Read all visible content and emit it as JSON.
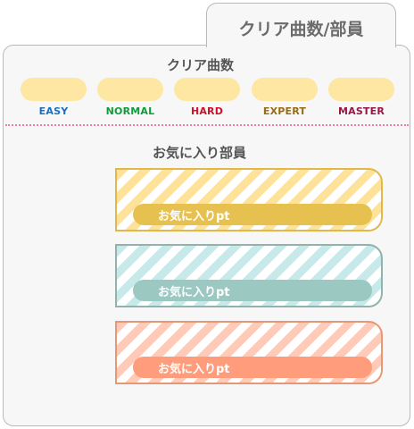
{
  "tab": {
    "title": "クリア曲数/部員"
  },
  "clear_counts": {
    "title": "クリア曲数",
    "difficulties": [
      {
        "label": "EASY",
        "color": "#1a6fc4"
      },
      {
        "label": "NORMAL",
        "color": "#0f9c3a"
      },
      {
        "label": "HARD",
        "color": "#d0102b"
      },
      {
        "label": "EXPERT",
        "color": "#9a6b12"
      },
      {
        "label": "MASTER",
        "color": "#9a1545"
      }
    ],
    "pill_color": "#fde7a3"
  },
  "favorite_members": {
    "title": "お気に入り部員",
    "cards": [
      {
        "label": "お気に入りpt",
        "theme": "yellow"
      },
      {
        "label": "お気に入りpt",
        "theme": "teal"
      },
      {
        "label": "お気に入りpt",
        "theme": "salmon"
      }
    ]
  },
  "colors": {
    "divider": "#f27aa9",
    "panel_bg": "#f7f7f7",
    "panel_border": "#b9b9b9"
  }
}
